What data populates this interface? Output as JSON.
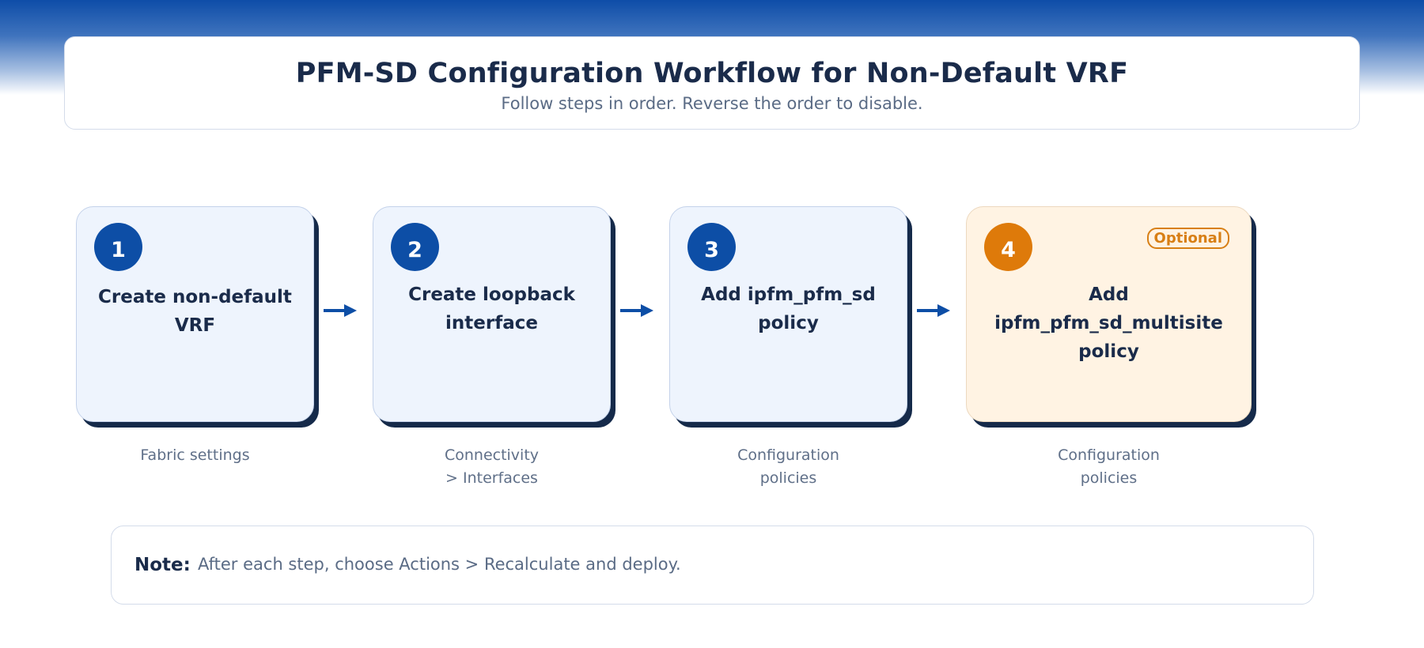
{
  "header": {
    "title": "PFM-SD Configuration Workflow for Non-Default VRF",
    "subtitle": "Follow steps in order. Reverse the order to disable."
  },
  "steps": [
    {
      "number": "1",
      "title_line1": "Create non-default",
      "title_line2": "VRF",
      "caption_line1": "Fabric settings",
      "caption_line2": ""
    },
    {
      "number": "2",
      "title_line1": "Create loopback",
      "title_line2": "interface",
      "caption_line1": "Connectivity",
      "caption_line2": "> Interfaces"
    },
    {
      "number": "3",
      "title_line1": "Add ipfm_pfm_sd",
      "title_line2": "policy",
      "caption_line1": "Configuration",
      "caption_line2": "policies"
    },
    {
      "number": "4",
      "title_line1": "Add ipfm_pfm_sd_multisite",
      "title_line2": "policy",
      "caption_line1": "Configuration",
      "caption_line2": "policies",
      "badge": "Optional"
    }
  ],
  "note": {
    "label": "Note:",
    "text": "After each step, choose Actions > Recalculate and deploy."
  },
  "colors": {
    "step_accent": "#0d4ea6",
    "optional_accent": "#de7a0a",
    "arrow": "#0d4ea6"
  }
}
